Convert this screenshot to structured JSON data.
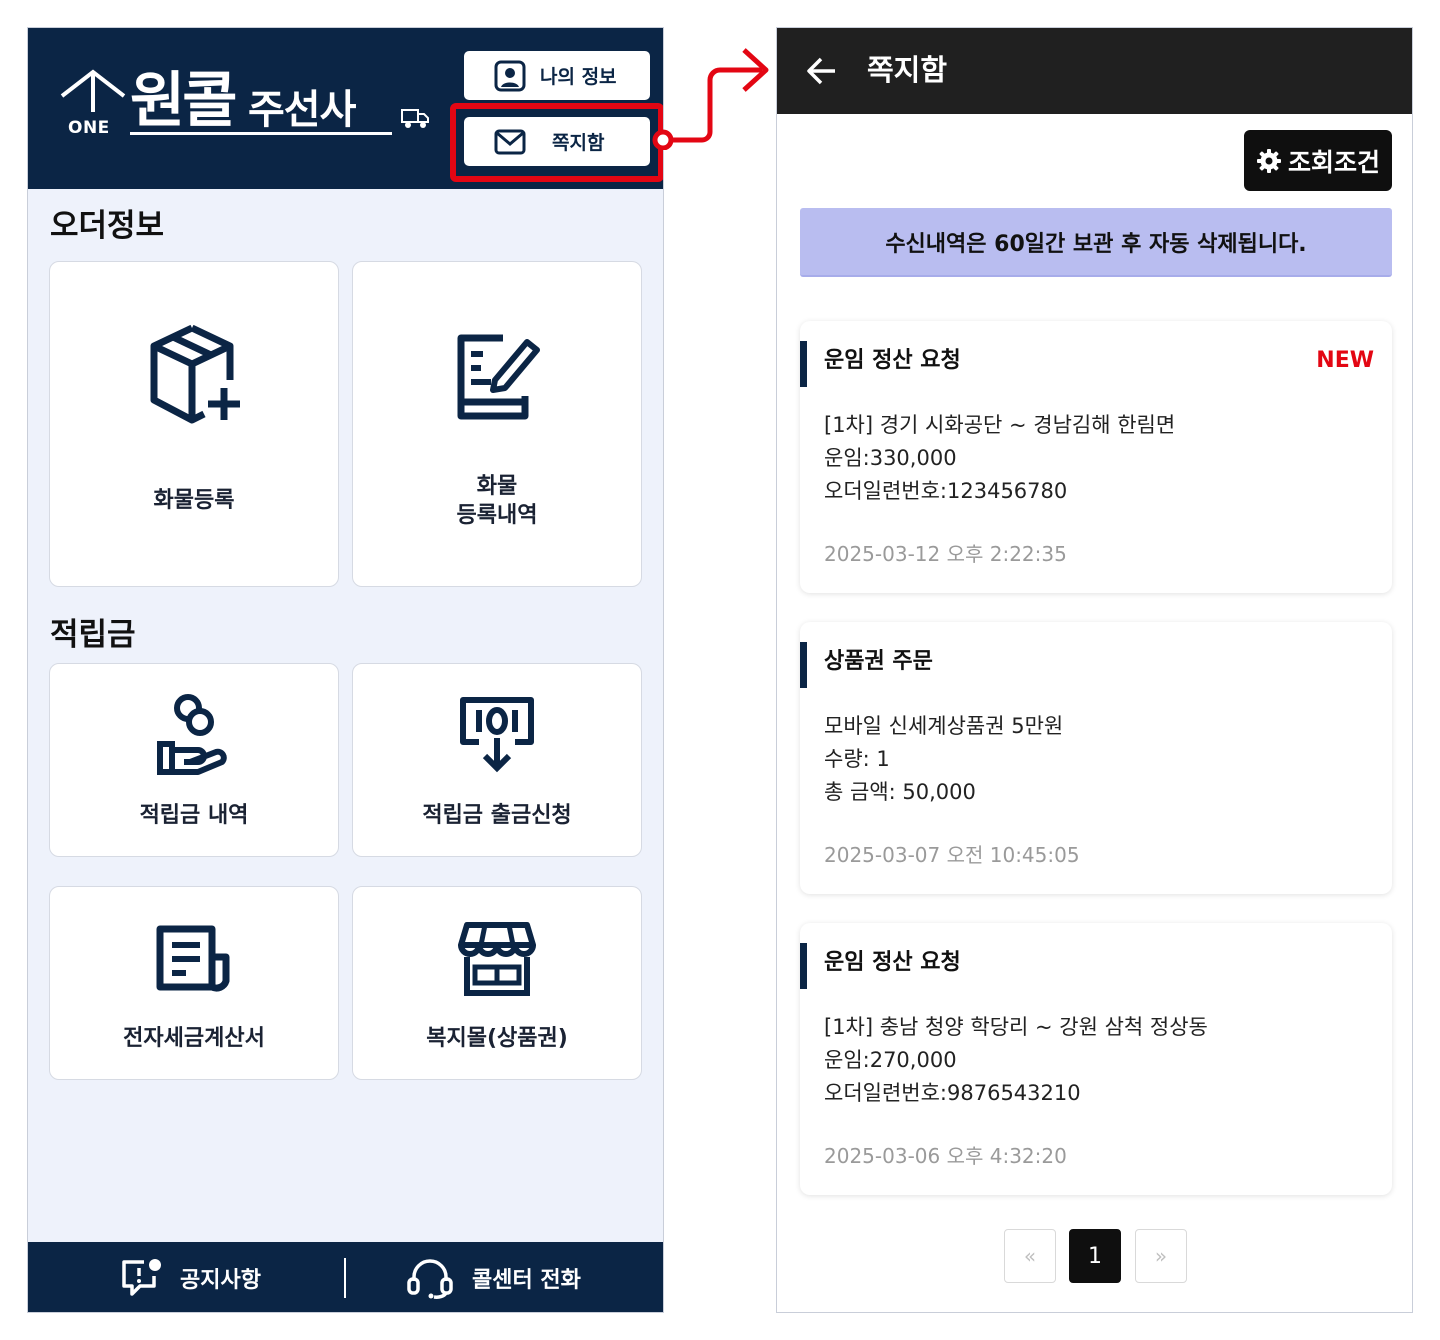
{
  "left": {
    "header": {
      "logo_one": "ONE",
      "logo_main": "원콜",
      "logo_sub": "주선사",
      "myinfo_label": "나의 정보",
      "mailbox_label": "쪽지함"
    },
    "order_section": {
      "title": "오더정보",
      "cards": [
        {
          "label": "화물등록",
          "icon": "box-plus-icon"
        },
        {
          "label_line1": "화물",
          "label_line2": "등록내역",
          "icon": "edit-list-icon"
        }
      ]
    },
    "points_section": {
      "title": "적립금",
      "cards": [
        {
          "label": "적립금 내역",
          "icon": "coin-hand-icon"
        },
        {
          "label": "적립금 출금신청",
          "icon": "cash-withdraw-icon"
        },
        {
          "label": "전자세금계산서",
          "icon": "invoice-icon"
        },
        {
          "label": "복지몰(상품권)",
          "icon": "store-icon"
        }
      ]
    },
    "footer": {
      "notice_label": "공지사항",
      "callcenter_label": "콜센터 전화"
    }
  },
  "right": {
    "header": {
      "title": "쪽지함"
    },
    "filter_label": "조회조건",
    "banner": "수신내역은 60일간 보관 후 자동 삭제됩니다.",
    "messages": [
      {
        "title": "운임 정산 요청",
        "badge": "NEW",
        "line1": "[1차] 경기 시화공단 ~ 경남김해 한림면",
        "line2": "운임:330,000",
        "line3": "오더일련번호:123456780",
        "date": "2025-03-12 오후 2:22:35"
      },
      {
        "title": "상품권 주문",
        "line1": "모바일 신세계상품권 5만원",
        "line2": "수량: 1",
        "line3": "총 금액: 50,000",
        "date": "2025-03-07 오전 10:45:05"
      },
      {
        "title": "운임 정산 요청",
        "line1": "[1차] 충남 청양 학당리 ~ 강원 삼척 정상동",
        "line2": "운임:270,000",
        "line3": "오더일련번호:9876543210",
        "date": "2025-03-06 오후 4:32:20"
      }
    ],
    "pagination": {
      "prev": "«",
      "current": "1",
      "next": "»"
    }
  },
  "colors": {
    "navy": "#0b2545",
    "highlight_red": "#e30613",
    "banner_lavender": "#b9bdf0",
    "header_dark": "#202020"
  }
}
